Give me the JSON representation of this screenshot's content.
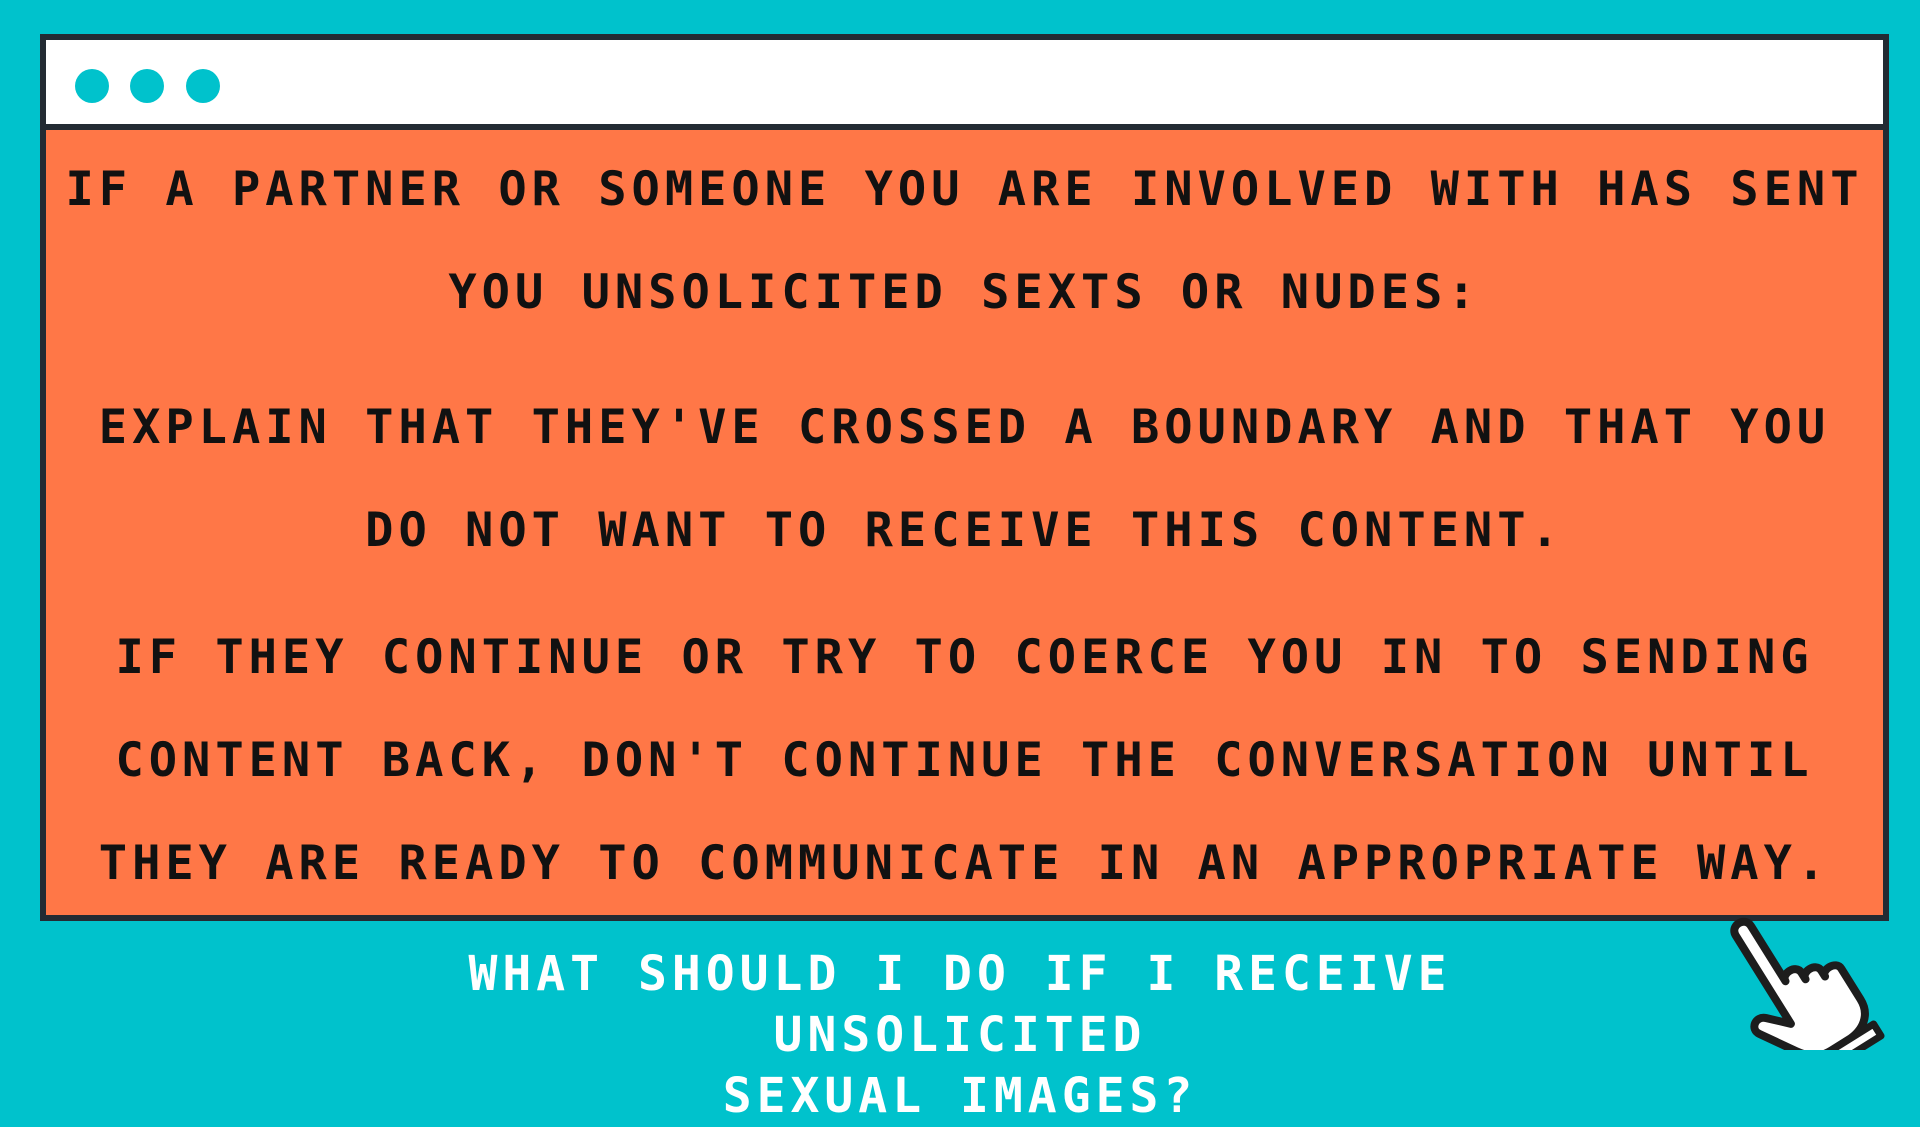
{
  "window": {
    "paragraphs": [
      "IF A PARTNER OR SOMEONE YOU ARE INVOLVED WITH HAS SENT YOU UNSOLICITED SEXTS OR NUDES:",
      "EXPLAIN THAT THEY'VE CROSSED A BOUNDARY AND THAT YOU DO NOT WANT TO RECEIVE THIS CONTENT.",
      "IF THEY CONTINUE OR TRY TO COERCE YOU IN TO SENDING CONTENT BACK, DON'T CONTINUE THE CONVERSATION UNTIL THEY ARE READY TO COMMUNICATE IN AN APPROPRIATE WAY."
    ]
  },
  "footer": {
    "line1": "WHAT SHOULD I DO IF I RECEIVE UNSOLICITED",
    "line2": "SEXUAL IMAGES?"
  },
  "icons": {
    "window_dots": "circle-icon",
    "cursor": "pointing-hand-cursor-icon"
  },
  "colors": {
    "background": "#00c2cc",
    "panel": "#ff7747",
    "titlebar": "#ffffff",
    "border": "#232b33",
    "dots": "#00c2cc",
    "footer_text": "#ffffff"
  }
}
